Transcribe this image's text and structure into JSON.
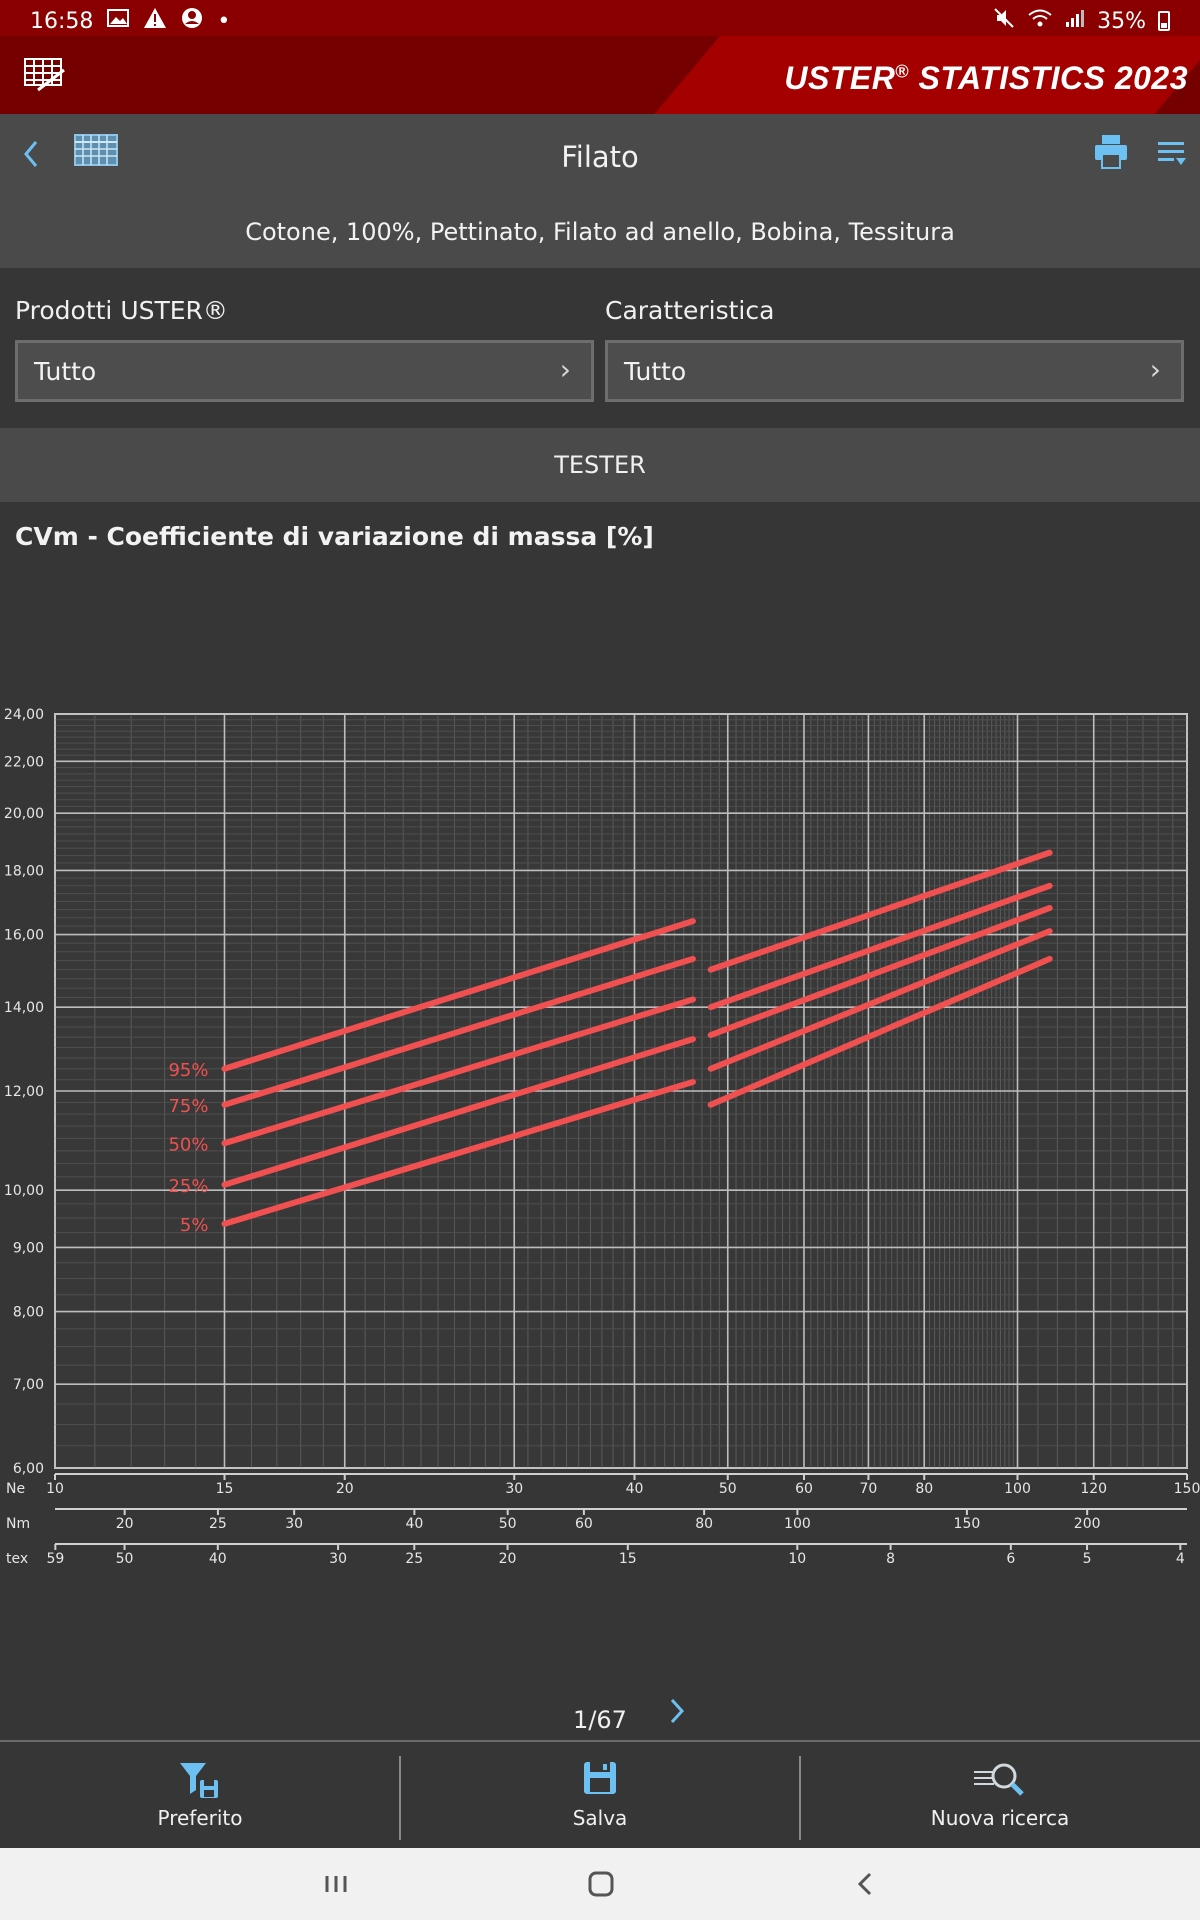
{
  "status_bar": {
    "time": "16:58",
    "battery": "35%"
  },
  "brand": {
    "name": "USTER",
    "reg": "®",
    "product": "STATISTICS 2023"
  },
  "navbar": {
    "title": "Filato"
  },
  "subtitle": "Cotone, 100%, Pettinato, Filato ad anello, Bobina, Tessitura",
  "filters": {
    "products_label": "Prodotti USTER®",
    "products_value": "Tutto",
    "characteristic_label": "Caratteristica",
    "characteristic_value": "Tutto"
  },
  "tester_label": "TESTER",
  "chart_title": "CVm - Coefficiente di variazione di massa [%]",
  "chart_data": {
    "type": "line",
    "y_scale": "log",
    "ylim": [
      6,
      24
    ],
    "y_ticks": [
      "24,00",
      "22,00",
      "20,00",
      "18,00",
      "16,00",
      "14,00",
      "12,00",
      "10,00",
      "9,00",
      "8,00",
      "7,00",
      "6,00"
    ],
    "x_scale": "log",
    "xlim": [
      10,
      150
    ],
    "axes": [
      {
        "name": "Ne",
        "ticks": [
          "10",
          "15",
          "20",
          "30",
          "40",
          "50",
          "60",
          "70",
          "80",
          "100",
          "120",
          "150"
        ]
      },
      {
        "name": "Nm",
        "ticks": [
          "20",
          "25",
          "30",
          "40",
          "50",
          "60",
          "80",
          "100",
          "150",
          "200"
        ]
      },
      {
        "name": "tex",
        "ticks": [
          "59",
          "50",
          "40",
          "30",
          "25",
          "20",
          "15",
          "10",
          "8",
          "6",
          "5",
          "4"
        ]
      }
    ],
    "series": [
      {
        "name": "95%",
        "segments": [
          {
            "x": [
              15,
              46
            ],
            "y": [
              12.5,
              16.4
            ]
          },
          {
            "x": [
              48,
              108
            ],
            "y": [
              15.0,
              18.6
            ]
          }
        ]
      },
      {
        "name": "75%",
        "segments": [
          {
            "x": [
              15,
              46
            ],
            "y": [
              11.7,
              15.3
            ]
          },
          {
            "x": [
              48,
              108
            ],
            "y": [
              14.0,
              17.5
            ]
          }
        ]
      },
      {
        "name": "50%",
        "segments": [
          {
            "x": [
              15,
              46
            ],
            "y": [
              10.9,
              14.2
            ]
          },
          {
            "x": [
              48,
              108
            ],
            "y": [
              13.3,
              16.8
            ]
          }
        ]
      },
      {
        "name": "25%",
        "segments": [
          {
            "x": [
              15,
              46
            ],
            "y": [
              10.1,
              13.2
            ]
          },
          {
            "x": [
              48,
              108
            ],
            "y": [
              12.5,
              16.1
            ]
          }
        ]
      },
      {
        "name": "5%",
        "segments": [
          {
            "x": [
              15,
              46
            ],
            "y": [
              9.4,
              12.2
            ]
          },
          {
            "x": [
              48,
              108
            ],
            "y": [
              11.7,
              15.3
            ]
          }
        ]
      }
    ],
    "line_color": "#f05050"
  },
  "pager": {
    "label": "1/67"
  },
  "toolbar": {
    "favorite": "Preferito",
    "save": "Salva",
    "new_search": "Nuova ricerca"
  }
}
